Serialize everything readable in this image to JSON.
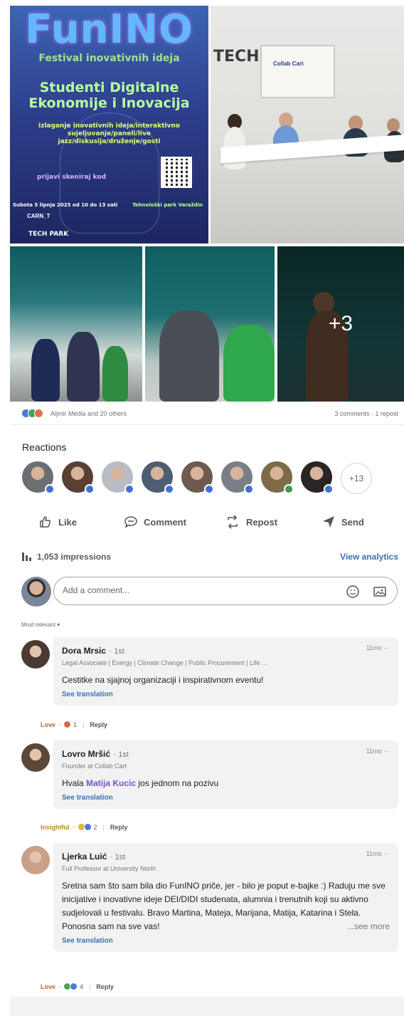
{
  "poster": {
    "brand": "FunINO",
    "subtitle": "Festival inovativnih ideja",
    "headline": "Studenti Digitalne Ekonomije i Inovacija",
    "activities": "izlaganje inovativnih ideja/interaktivno sujeljuvanje/paneli/live jazz/diskusija/druženje/gosti",
    "registration": "prijavi skeniraj kod",
    "date": "Subota 5 lipnja 2025 od 10 do 13 sati",
    "venue": "Tehnološki park Varaždin",
    "sponsor": "CARN_T",
    "logo": "TECH PARK"
  },
  "room_photo": {
    "sign": "TECH PARK",
    "screen_logo": "Collab Cart"
  },
  "collage": {
    "more_count": "+3"
  },
  "social": {
    "names": "Aljmir Media and 20 others",
    "counts": "3 comments · 1 repost"
  },
  "reactions": {
    "title": "Reactions",
    "more": "+13",
    "avatar_colors": [
      "#6b6e73",
      "#5a4032",
      "#b8bcc3",
      "#4c5d74",
      "#6e5a4e",
      "#7a7f86",
      "#7f6a47",
      "#2a2424"
    ]
  },
  "actions": {
    "like": "Like",
    "comment": "Comment",
    "repost": "Repost",
    "send": "Send"
  },
  "impressions": {
    "text": "1,053 impressions",
    "link": "View analytics"
  },
  "comment_box": {
    "placeholder": "Add a comment..."
  },
  "sort": "Most relevant ▾",
  "comments": [
    {
      "name": "Dora Mrsic",
      "degree": "· 1st",
      "headline": "Legal Associate | Energy | Climate Change | Public Procurement | Life ...",
      "time": "11mo ···",
      "text": "Cestitke na sjajnoj organizaciji i inspirativnom eventu!",
      "translate": "See translation",
      "reaction": "Love",
      "reaction_count": "1",
      "reply": "Reply",
      "avatar_color": "#4a3a33"
    },
    {
      "name": "Lovro Mršić",
      "degree": "· 1st",
      "headline": "Founder at Collab Cart",
      "time": "11mo ···",
      "text_before": "Hvala ",
      "mention": "Matija Kucic",
      "text_after": " jos jednom na pozivu",
      "translate": "See translation",
      "reaction": "Insightful",
      "reaction_count": "2",
      "reply": "Reply",
      "avatar_color": "#5b4838"
    },
    {
      "name": "Ljerka Luić",
      "degree": "· 1st",
      "headline": "Full Professor at University North",
      "time": "11mo ···",
      "text": "Sretna sam što sam bila dio FunINO priče, jer - bilo je poput e-bajke :) Raduju me sve inicijative i inovativne ideje DEI/DIDI studenata, alumnia i trenutnih koji su aktivno sudjelovali u festivalu. Bravo Martina, Mateja, Marijana, Matija, Katarina i Stela. Ponosna sam na sve vas!",
      "see_more": "...see more",
      "translate": "See translation",
      "reaction": "Love",
      "reaction_count": "4",
      "reply": "Reply",
      "avatar_color": "#c9a089"
    }
  ]
}
